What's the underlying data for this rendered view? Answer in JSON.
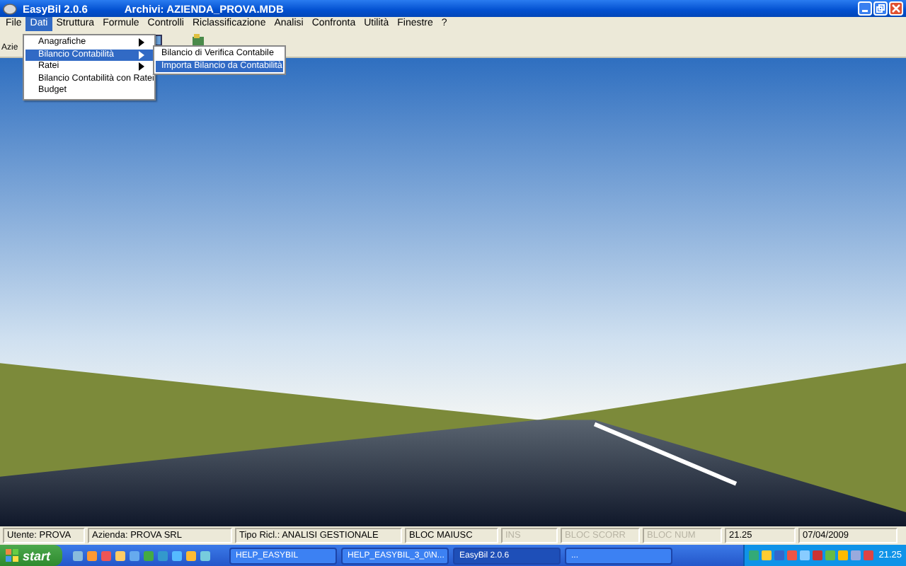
{
  "window": {
    "title": "EasyBil  2.0.6",
    "archive": "Archivi: AZIENDA_PROVA.MDB"
  },
  "menu_bar": [
    {
      "label": "File",
      "selected": false
    },
    {
      "label": "Dati",
      "selected": true
    },
    {
      "label": "Struttura",
      "selected": false
    },
    {
      "label": "Formule",
      "selected": false
    },
    {
      "label": "Controlli",
      "selected": false
    },
    {
      "label": "Riclassificazione",
      "selected": false
    },
    {
      "label": "Analisi",
      "selected": false
    },
    {
      "label": "Confronta",
      "selected": false
    },
    {
      "label": "Utilità",
      "selected": false
    },
    {
      "label": "Finestre",
      "selected": false
    },
    {
      "label": "?",
      "selected": false
    }
  ],
  "toolbar": {
    "label": "Azie"
  },
  "dropdown": [
    {
      "label": "Anagrafiche",
      "submenu": true,
      "selected": false
    },
    {
      "label": "Bilancio Contabilità",
      "submenu": true,
      "selected": true
    },
    {
      "label": "Ratei",
      "submenu": true,
      "selected": false
    },
    {
      "label": "Bilancio Contabilità con Ratei",
      "submenu": false,
      "selected": false
    },
    {
      "label": "Budget",
      "submenu": false,
      "selected": false
    }
  ],
  "submenu": [
    {
      "label": "Bilancio di Verifica Contabile",
      "selected": false
    },
    {
      "label": "Importa Bilancio da Contabilità",
      "selected": true
    }
  ],
  "status_bar": [
    {
      "text": "Utente: PROVA",
      "disabled": false
    },
    {
      "text": "Azienda: PROVA SRL",
      "disabled": false
    },
    {
      "text": "Tipo Ricl.: ANALISI GESTIONALE",
      "disabled": false
    },
    {
      "text": "BLOC MAIUSC",
      "disabled": false
    },
    {
      "text": "INS",
      "disabled": true
    },
    {
      "text": "BLOC SCORR",
      "disabled": true
    },
    {
      "text": "BLOC NUM",
      "disabled": true
    },
    {
      "text": "21.25",
      "disabled": false
    },
    {
      "text": "07/04/2009",
      "disabled": false
    }
  ],
  "taskbar": {
    "start": "start",
    "buttons": [
      {
        "label": "HELP_EASYBIL",
        "selected": false
      },
      {
        "label": "HELP_EASYBIL_3_0\\N...",
        "selected": false
      },
      {
        "label": "EasyBil  2.0.6",
        "selected": true
      },
      {
        "label": "...",
        "selected": false
      }
    ],
    "clock": "21.25"
  }
}
